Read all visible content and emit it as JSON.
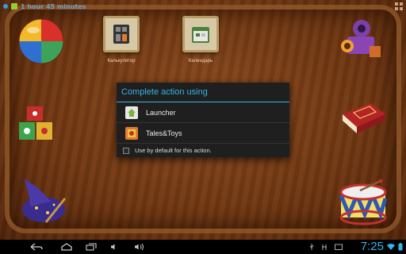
{
  "status_bar": {
    "timer_text": "1 hour 45 minutes"
  },
  "home": {
    "apps": [
      {
        "label": "Калькулятор"
      },
      {
        "label": "Календарь"
      }
    ]
  },
  "dialog": {
    "title": "Complete action using",
    "options": [
      {
        "label": "Launcher",
        "icon": "launcher-app-icon"
      },
      {
        "label": "Tales&Toys",
        "icon": "tales-toys-app-icon"
      }
    ],
    "checkbox_label": "Use by default for this action.",
    "checkbox_checked": false
  },
  "nav_bar": {
    "clock": "7:25"
  },
  "colors": {
    "accent": "#33b5e5",
    "dialog_bg": "#1f1f1f",
    "wood": "#6e3612"
  }
}
